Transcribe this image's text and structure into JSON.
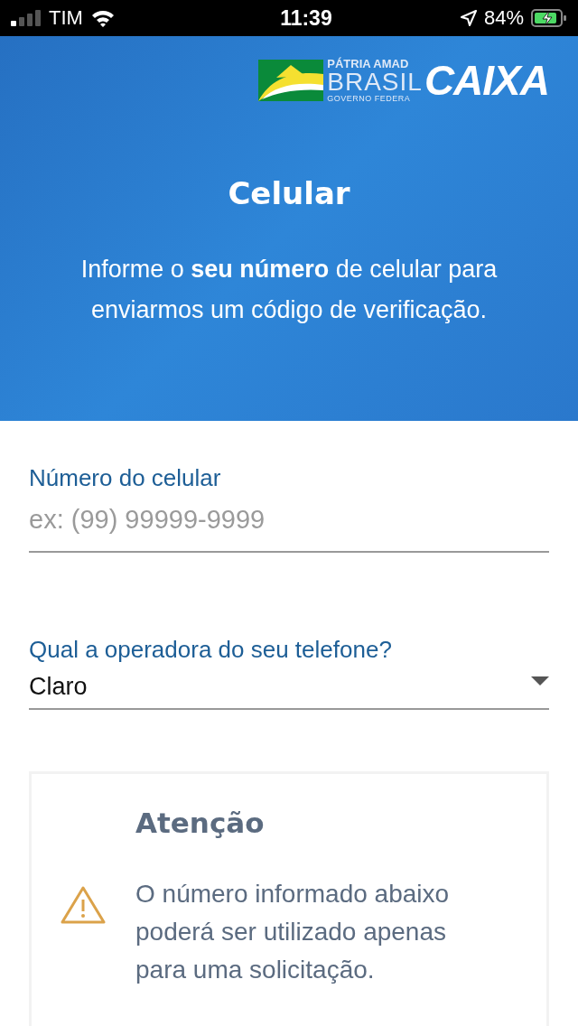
{
  "status_bar": {
    "carrier": "TIM",
    "time": "11:39",
    "battery": "84%"
  },
  "header": {
    "logo": {
      "motto": "PÁTRIA AMAD",
      "country": "BRASIL",
      "government": "GOVERNO FEDERA",
      "brand": "CAIXA"
    },
    "title": "Celular",
    "description": "Informe o **seu número** de celular para enviarmos um código de verificação."
  },
  "form": {
    "phone": {
      "label": "Número do celular",
      "placeholder": "ex: (99) 99999-9999"
    },
    "carrier": {
      "label": "Qual a operadora do seu telefone?",
      "value": "Claro"
    }
  },
  "notice": {
    "title": "Atenção",
    "text": "O número informado abaixo poderá ser utilizado apenas para uma solicitação."
  }
}
